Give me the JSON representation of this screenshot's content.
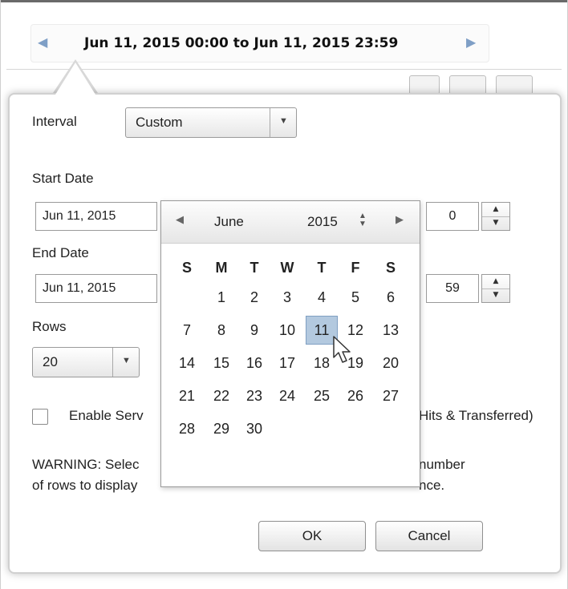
{
  "range_bar": {
    "prev_arrow": "◀",
    "next_arrow": "▶",
    "text": "Jun 11, 2015 00:00 to Jun 11, 2015 23:59"
  },
  "form": {
    "interval_label": "Interval",
    "interval_value": "Custom",
    "start_date_label": "Start Date",
    "start_date_value": "Jun 11, 2015",
    "start_hour_value": "0",
    "end_date_label": "End Date",
    "end_date_value": "Jun 11, 2015",
    "end_minute_value": "59",
    "rows_label": "Rows",
    "rows_value": "20",
    "checkbox_label": "Enable Serv",
    "checkbox_label_tail": "Hits & Transferred)",
    "warning_line1_a": "WARNING: Selec",
    "warning_line1_b": "number",
    "warning_line2_a": "of rows to display",
    "warning_line2_b": "nce.",
    "ok_label": "OK",
    "cancel_label": "Cancel"
  },
  "calendar": {
    "month": "June",
    "year": "2015",
    "year_stepper": "≑",
    "prev_icon": "◀",
    "next_icon": "▶",
    "weekdays": [
      "S",
      "M",
      "T",
      "W",
      "T",
      "F",
      "S"
    ],
    "weeks": [
      [
        "",
        "1",
        "2",
        "3",
        "4",
        "5",
        "6"
      ],
      [
        "7",
        "8",
        "9",
        "10",
        "11",
        "12",
        "13"
      ],
      [
        "14",
        "15",
        "16",
        "17",
        "18",
        "19",
        "20"
      ],
      [
        "21",
        "22",
        "23",
        "24",
        "25",
        "26",
        "27"
      ],
      [
        "28",
        "29",
        "30",
        "",
        "",
        "",
        ""
      ]
    ],
    "selected_day": "11"
  },
  "colors": {
    "accent_arrow": "#7f9fc6",
    "selected_day_bg": "#b3c9df"
  },
  "icons": {
    "dropdown": "chevron-down-icon",
    "spinner": "spinner-icon",
    "cursor": "mouse-pointer-icon"
  }
}
